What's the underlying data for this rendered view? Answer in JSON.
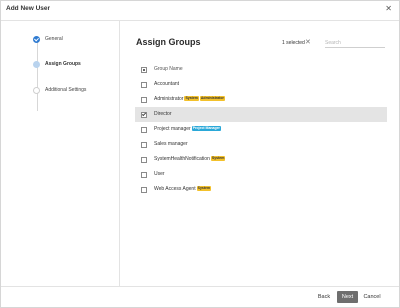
{
  "window": {
    "title": "Add New User",
    "close_icon": "close-icon"
  },
  "stepper": {
    "steps": [
      {
        "label": "General",
        "state": "done"
      },
      {
        "label": "Assign Groups",
        "state": "active"
      },
      {
        "label": "Additional Settings",
        "state": "pending"
      }
    ]
  },
  "main": {
    "heading": "Assign Groups",
    "selected_text": "1 selected",
    "search_placeholder": "Search",
    "columns": {
      "name": "Group Name"
    },
    "rows": [
      {
        "name": "Accountant",
        "checked": false,
        "badges": []
      },
      {
        "name": "Administrator",
        "checked": false,
        "badges": [
          "System",
          "Administrator"
        ]
      },
      {
        "name": "Director",
        "checked": true,
        "badges": []
      },
      {
        "name": "Project manager",
        "checked": false,
        "badges": [
          "Project Manager"
        ]
      },
      {
        "name": "Sales manager",
        "checked": false,
        "badges": []
      },
      {
        "name": "SystemHealthNotification",
        "checked": false,
        "badges": [
          "System"
        ]
      },
      {
        "name": "User",
        "checked": false,
        "badges": []
      },
      {
        "name": "Web Access Agent",
        "checked": false,
        "badges": [
          "System"
        ]
      }
    ]
  },
  "footer": {
    "back_label": "Back",
    "next_label": "Next",
    "cancel_label": "Cancel"
  },
  "colors": {
    "accent": "#2f7bd1",
    "badge_system": "#f3c12b",
    "badge_pm": "#2aa8d8",
    "next_button": "#6e6e6e",
    "selected_row": "#e4e4e4"
  }
}
